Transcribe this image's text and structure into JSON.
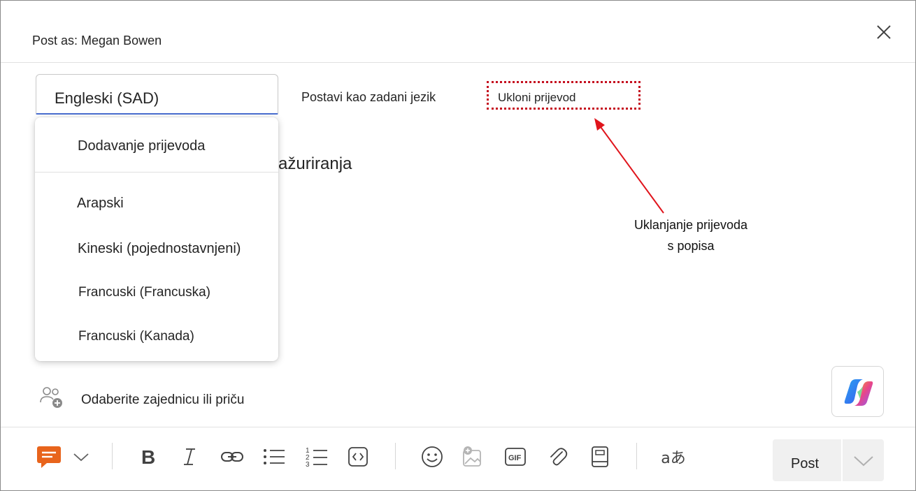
{
  "header": {
    "post_as": "Post as: Megan Bowen"
  },
  "language_bar": {
    "selected_language": "Engleski (SAD)",
    "set_default_label": "Postavi kao zadani jezik",
    "remove_translation_label": "Ukloni prijevod"
  },
  "editor": {
    "body_text_fragment": "ažuriranja"
  },
  "dropdown": {
    "add_translation": "Dodavanje prijevoda",
    "languages": [
      "Arapski",
      "Kineski (pojednostavnjeni)",
      "Francuski (Francuska)",
      "Francuski (Kanada)"
    ]
  },
  "annotation": {
    "line1": "Uklanjanje prijevoda",
    "line2": "s popisa",
    "color": "#e0141c"
  },
  "community": {
    "label": "Odaberite zajednicu ili priču"
  },
  "toolbar": {
    "post_label": "Post",
    "translate_icon_text": "aあ",
    "icons": [
      "praise-icon",
      "bold-icon",
      "italic-icon",
      "link-icon",
      "bullet-list-icon",
      "numbered-list-icon",
      "code-icon",
      "emoji-icon",
      "image-icon",
      "gif-icon",
      "attach-icon",
      "book-icon",
      "translate-icon"
    ]
  },
  "colors": {
    "accent_underline": "#4a6fd1",
    "praise_orange": "#e8641c",
    "dotted_highlight": "#c50f1f"
  }
}
